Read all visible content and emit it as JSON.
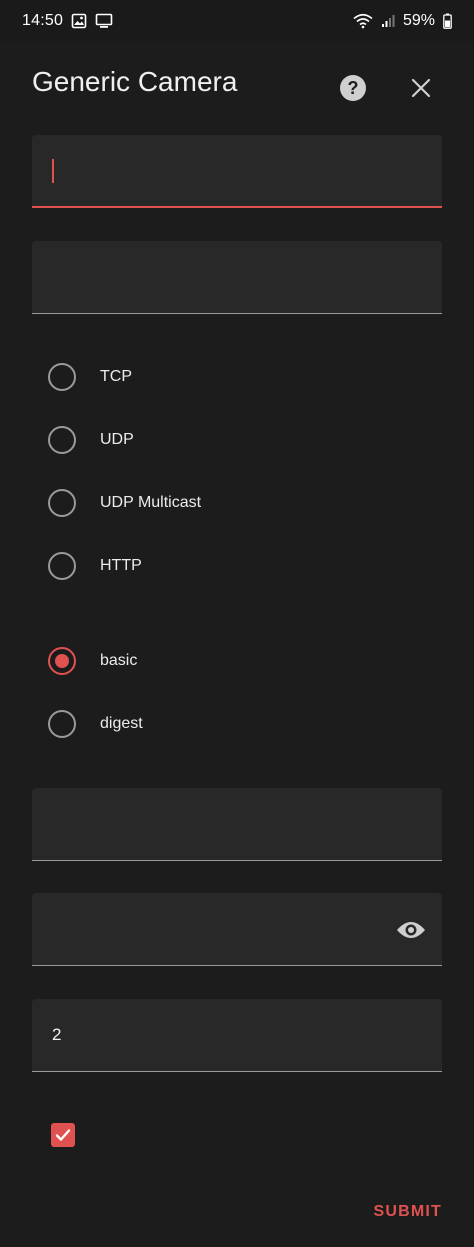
{
  "status_bar": {
    "time": "14:50",
    "battery": "59%"
  },
  "dialog": {
    "title": "Generic Camera",
    "help_icon": "help-circle-icon",
    "close_icon": "close-icon"
  },
  "form": {
    "field_1": {
      "value": ""
    },
    "field_2": {
      "value": ""
    },
    "protocol_options": [
      {
        "label": "TCP",
        "checked": false
      },
      {
        "label": "UDP",
        "checked": false
      },
      {
        "label": "UDP Multicast",
        "checked": false
      },
      {
        "label": "HTTP",
        "checked": false
      }
    ],
    "auth_options": [
      {
        "label": "basic",
        "checked": true
      },
      {
        "label": "digest",
        "checked": false
      }
    ],
    "field_3": {
      "value": ""
    },
    "password_field": {
      "value": "",
      "icon": "eye-icon"
    },
    "field_5": {
      "value": "2"
    },
    "checkbox": {
      "checked": true
    },
    "submit_label": "SUBMIT"
  },
  "colors": {
    "accent": "#e0524f",
    "background": "#1c1c1c",
    "field": "#282828"
  }
}
